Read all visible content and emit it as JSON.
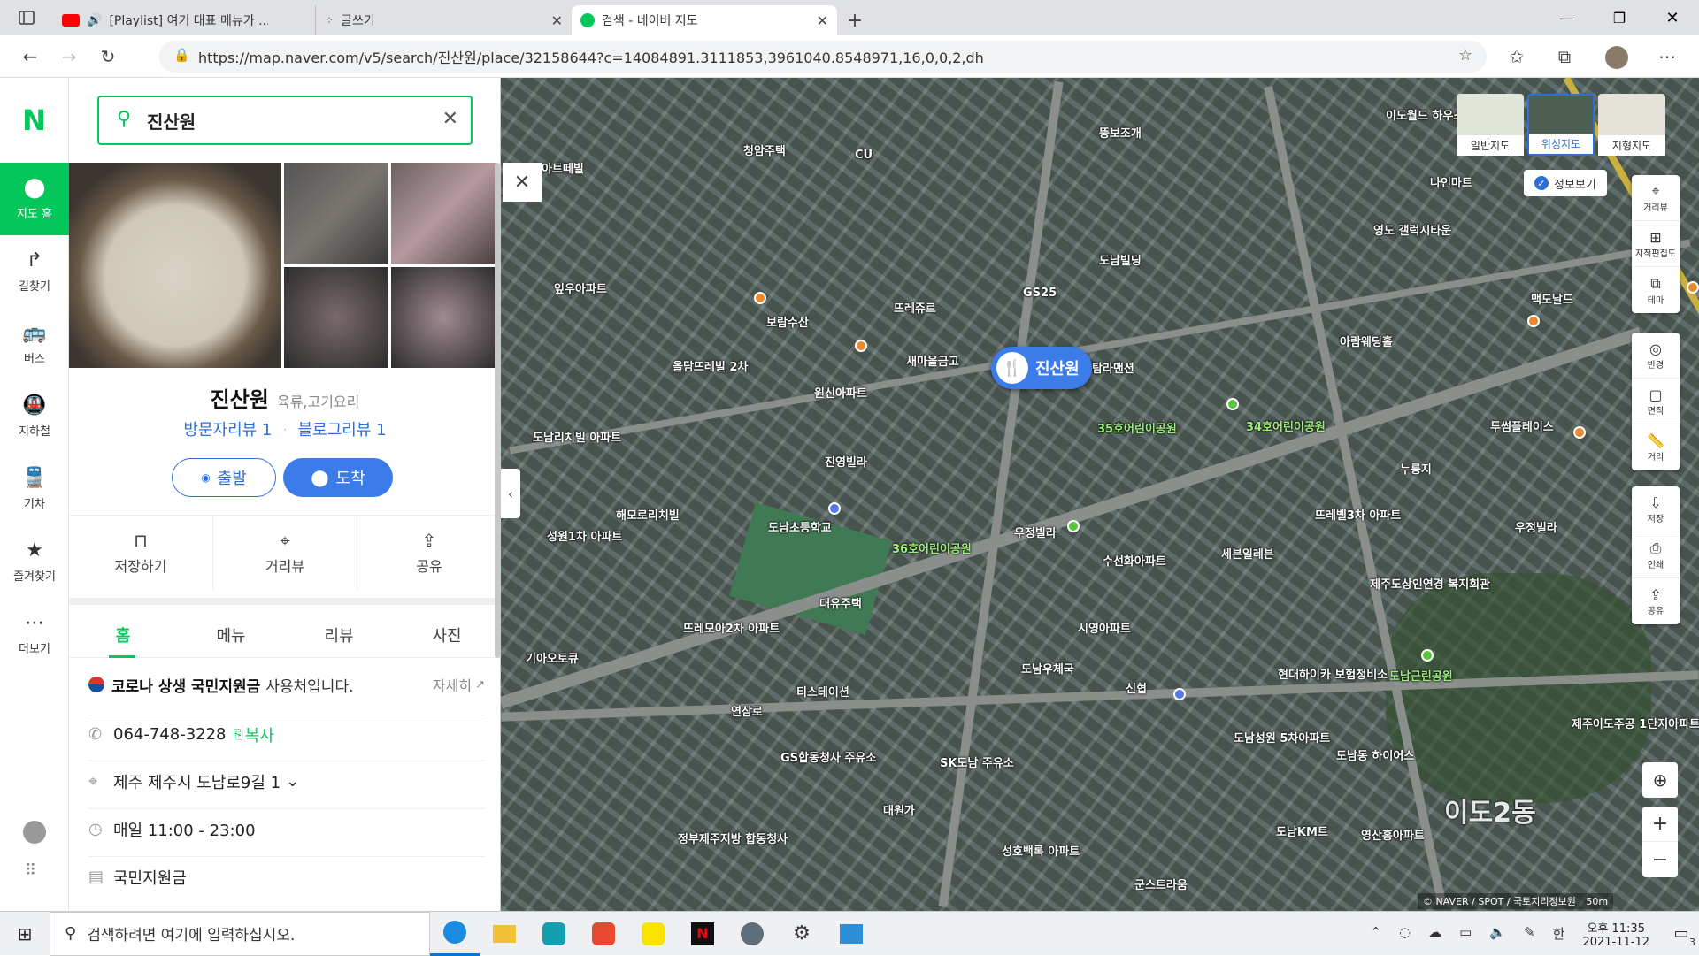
{
  "browser": {
    "tabs": [
      {
        "title": "[Playlist] 여기 대표 메뉴가 ..."
      },
      {
        "title": "글쓰기"
      },
      {
        "title": "검색 - 네이버 지도"
      }
    ],
    "url": "https://map.naver.com/v5/search/진산원/place/32158644?c=14084891.3111853,3961040.8548971,16,0,0,2,dh"
  },
  "leftnav": {
    "logo": "N",
    "items": [
      {
        "label": "지도 홈",
        "icon": "map-home-icon"
      },
      {
        "label": "길찾기",
        "icon": "directions-icon"
      },
      {
        "label": "버스",
        "icon": "bus-icon"
      },
      {
        "label": "지하철",
        "icon": "subway-icon"
      },
      {
        "label": "기차",
        "icon": "train-icon"
      },
      {
        "label": "즐겨찾기",
        "icon": "star-icon"
      },
      {
        "label": "더보기",
        "icon": "more-icon"
      }
    ]
  },
  "search": {
    "value": "진산원"
  },
  "place": {
    "name": "진산원",
    "category": "육류,고기요리",
    "visitor_review": "방문자리뷰 1",
    "blog_review": "블로그리뷰 1",
    "depart_label": "출발",
    "arrive_label": "도착",
    "actions": [
      "저장하기",
      "거리뷰",
      "공유"
    ],
    "tabs": [
      "홈",
      "메뉴",
      "리뷰",
      "사진"
    ],
    "notice_strong": "코로나 상생 국민지원금",
    "notice_text": "사용처입니다.",
    "notice_more": "자세히",
    "phone": "064-748-3228",
    "copy_label": "복사",
    "address": "제주 제주시 도남로9길 1",
    "hours": "매일 11:00 - 23:00",
    "extra": "국민지원금"
  },
  "map": {
    "layer_buttons": [
      "일반지도",
      "위성지도",
      "지형지도"
    ],
    "info_toggle": "정보보기",
    "tools": [
      "거리뷰",
      "지적편집도",
      "테마",
      "반경",
      "면적",
      "거리",
      "저장",
      "인쇄",
      "공유"
    ],
    "marker_label": "진산원",
    "copyright": "© NAVER / SPOT / 국토지리정보원",
    "scale": "50m",
    "labels": [
      "뚱보조개",
      "청암주택",
      "CU",
      "아트떼빌",
      "잎우아파트",
      "보람수산",
      "뜨레쥬르",
      "GS25",
      "새마을금고",
      "도남빌딩",
      "원신아파트",
      "올담뜨레빌 2차",
      "도남리치빌 아파트",
      "진영빌라",
      "해모로리치빌",
      "도남초등학교",
      "36호어린이공원",
      "35호어린이공원",
      "34호어린이공원",
      "우정빌라",
      "수선화아파트",
      "세븐일레븐",
      "뜨레벨3차 아파트",
      "제주도상인연경 복지회관",
      "대유주택",
      "뜨레모아2차 아파트",
      "시영아파트",
      "도남우체국",
      "신협",
      "티스테이션",
      "현대하이카 보험청비소",
      "도남근린공원",
      "GS합동청사 주유소",
      "SK도남 주유소",
      "대원가",
      "정부제주지방 합동청사",
      "성호백록 아파트",
      "도남성원 5차아파트",
      "도남동 하이어스",
      "도남KM트",
      "영산홍아파트",
      "군스트라움",
      "이도2동",
      "이도월드 하우스",
      "나인마트",
      "영도 갤럭시타운",
      "맥도날드",
      "아람웨딩홀",
      "투썸플레이스",
      "누룽지",
      "우정빌라",
      "제주이도주공 1단지아파트",
      "탐라맨션",
      "연삼로",
      "성원1차 아파트",
      "기아오토큐"
    ]
  },
  "taskbar": {
    "search_placeholder": "검색하려면 여기에 입력하십시오.",
    "time": "오후 11:35",
    "date": "2021-11-12",
    "ime": "한",
    "notifications": "3"
  }
}
